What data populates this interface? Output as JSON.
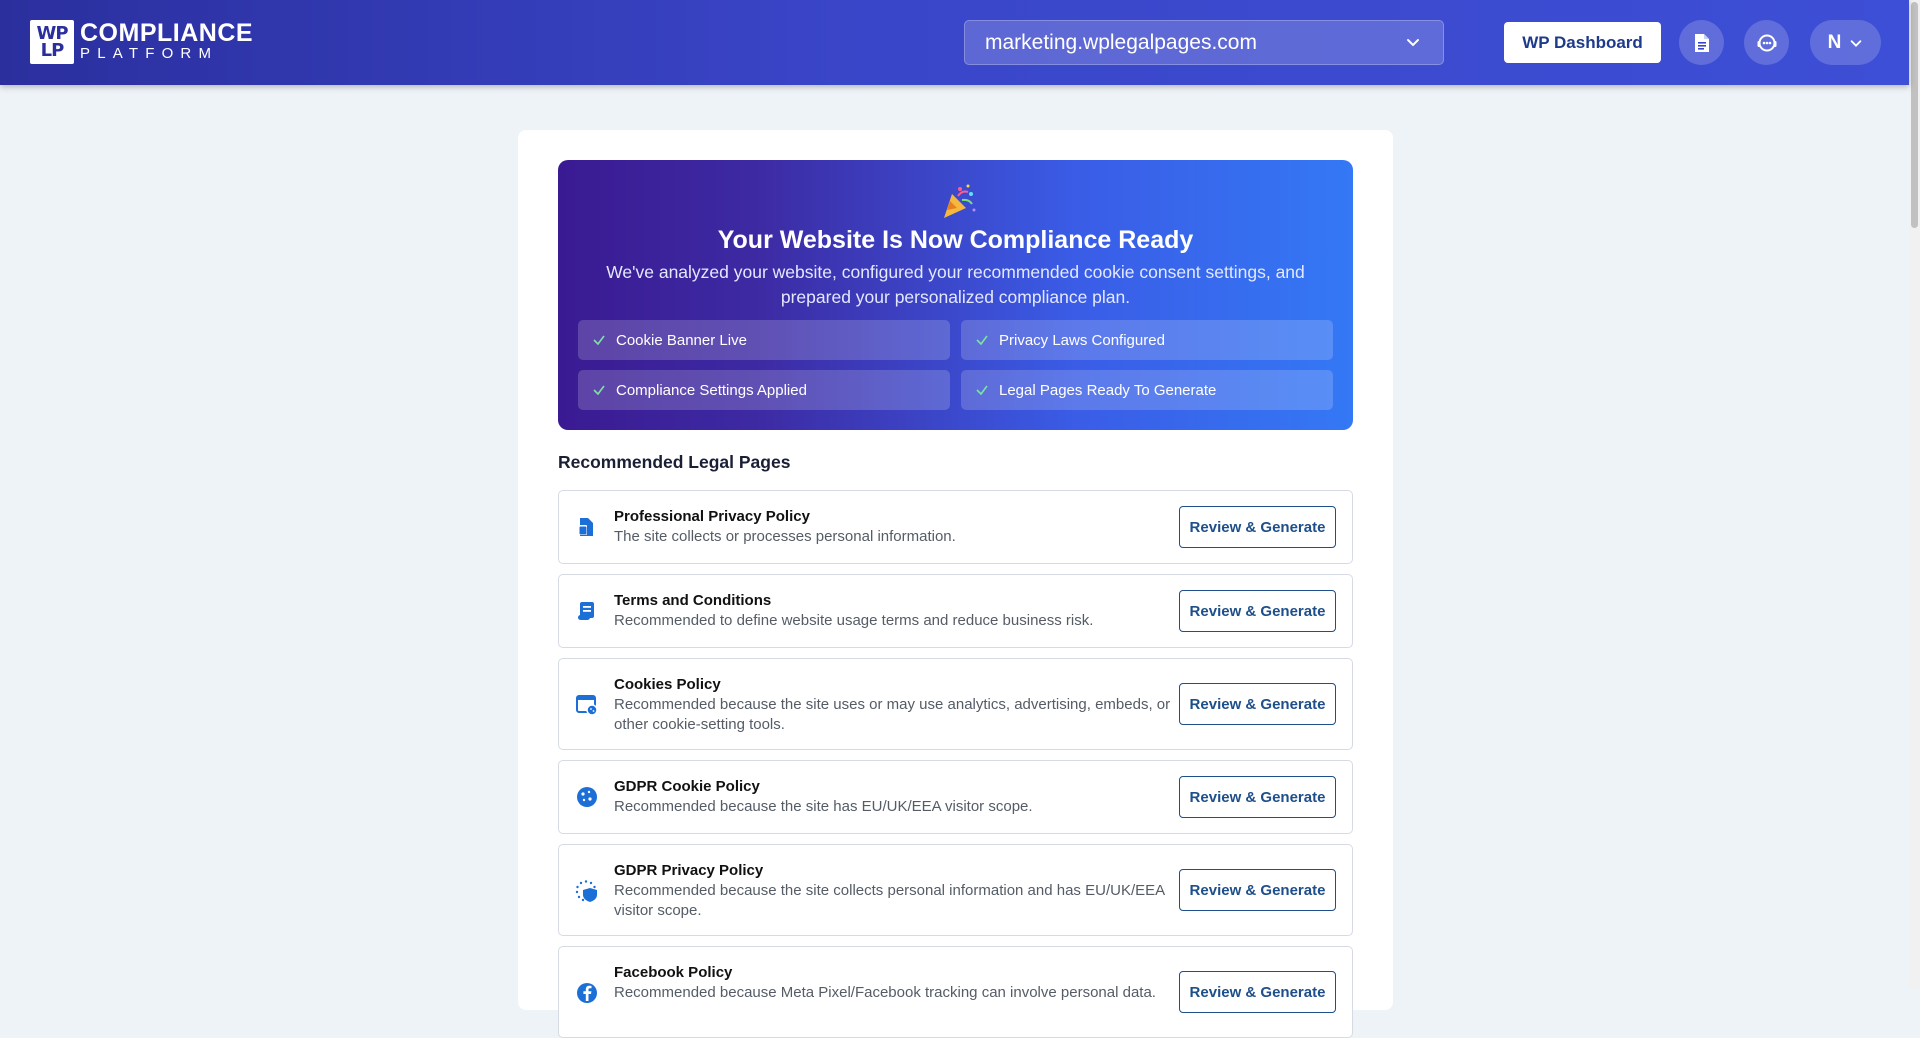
{
  "header": {
    "logo_mark_top": "WP",
    "logo_mark_bottom": "LP",
    "logo_line1": "COMPLIANCE",
    "logo_line2": "PLATFORM",
    "site_selected": "marketing.wplegalpages.com",
    "wp_dashboard_label": "WP Dashboard",
    "user_initial": "N"
  },
  "hero": {
    "title": "Your Website Is Now Compliance Ready",
    "subtitle": "We've analyzed your website, configured your recommended cookie consent settings, and prepared your personalized compliance plan.",
    "pills": [
      "Cookie Banner Live",
      "Privacy Laws Configured",
      "Compliance Settings Applied",
      "Legal Pages Ready To Generate"
    ]
  },
  "section_title": "Recommended Legal Pages",
  "button_label": "Review & Generate",
  "items": [
    {
      "name": "Professional Privacy Policy",
      "desc": "The site collects or processes personal information.",
      "icon": "document-stack-icon"
    },
    {
      "name": "Terms and Conditions",
      "desc": "Recommended to define website usage terms and reduce business risk.",
      "icon": "scroll-icon"
    },
    {
      "name": "Cookies Policy",
      "desc": "Recommended because the site uses or may use analytics, advertising, embeds, or other cookie-setting tools.",
      "icon": "browser-cookie-icon"
    },
    {
      "name": "GDPR Cookie Policy",
      "desc": "Recommended because the site has EU/UK/EEA visitor scope.",
      "icon": "cookie-icon"
    },
    {
      "name": "GDPR Privacy Policy",
      "desc": "Recommended because the site collects personal information and has EU/UK/EEA visitor scope.",
      "icon": "eu-shield-icon"
    },
    {
      "name": "Facebook Policy",
      "desc": "Recommended because Meta Pixel/Facebook tracking can involve personal data.",
      "icon": "facebook-icon"
    }
  ],
  "colors": {
    "topbar": "#3a46c9",
    "hero_start": "#3a1a92",
    "hero_end": "#3478f5",
    "button_text": "#1e4f8a",
    "page_bg": "#eef3f7"
  }
}
